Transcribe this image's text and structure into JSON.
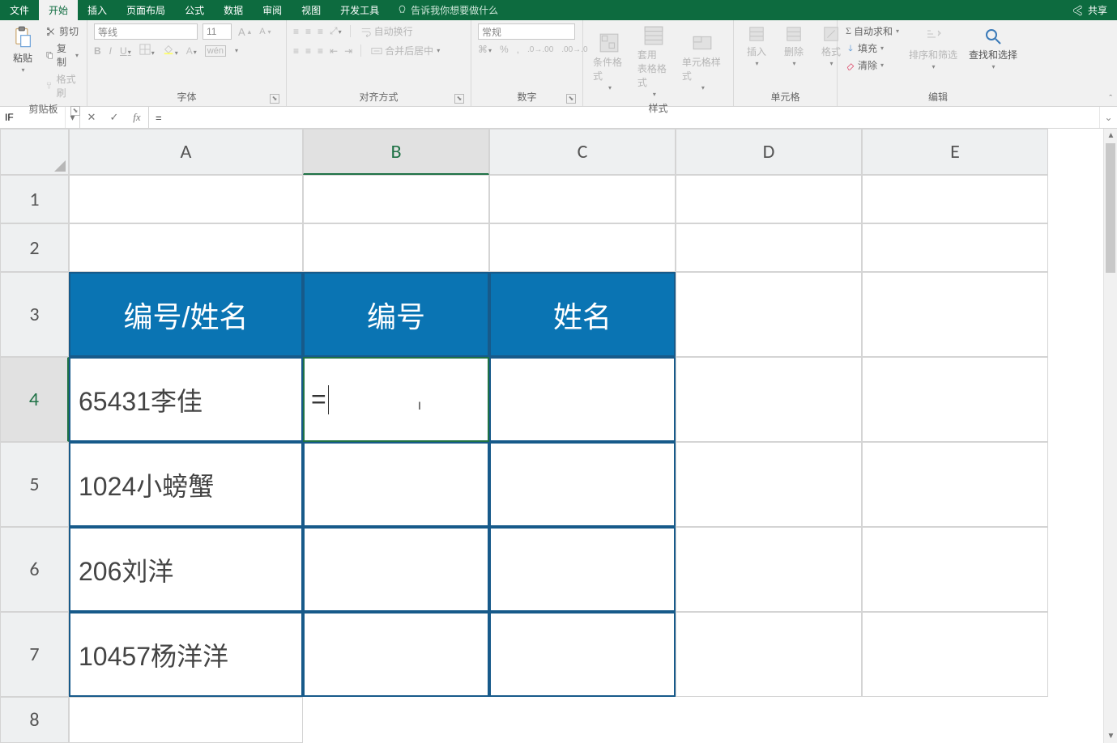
{
  "tabs": {
    "file": "文件",
    "home": "开始",
    "insert": "插入",
    "layout": "页面布局",
    "formulas": "公式",
    "data": "数据",
    "review": "审阅",
    "view": "视图",
    "dev": "开发工具",
    "tell": "告诉我你想要做什么",
    "share": "共享"
  },
  "ribbon": {
    "clipboard": {
      "paste": "粘贴",
      "cut": "剪切",
      "copy": "复制",
      "format_painter": "格式刷",
      "label": "剪贴板"
    },
    "font": {
      "name": "等线",
      "size": "11",
      "label": "字体"
    },
    "align": {
      "wrap": "自动换行",
      "merge": "合并后居中",
      "label": "对齐方式"
    },
    "number": {
      "format": "常规",
      "label": "数字"
    },
    "styles": {
      "cond": "条件格式",
      "table": "套用\n表格格式",
      "cell": "单元格样式",
      "label": "样式"
    },
    "cells": {
      "insert": "插入",
      "delete": "删除",
      "format": "格式",
      "label": "单元格"
    },
    "editing": {
      "sum": "自动求和",
      "fill": "填充",
      "clear": "清除",
      "sort": "排序和筛选",
      "find": "查找和选择",
      "label": "编辑"
    }
  },
  "formula_bar": {
    "name_box": "IF",
    "formula": "="
  },
  "columns": [
    "A",
    "B",
    "C",
    "D",
    "E"
  ],
  "rows": [
    "1",
    "2",
    "3",
    "4",
    "5",
    "6",
    "7",
    "8"
  ],
  "table": {
    "headers": {
      "A": "编号/姓名",
      "B": "编号",
      "C": "姓名"
    },
    "data": [
      {
        "A": "65431李佳",
        "B": "=",
        "C": ""
      },
      {
        "A": "1024小螃蟹",
        "B": "",
        "C": ""
      },
      {
        "A": "206刘洋",
        "B": "",
        "C": ""
      },
      {
        "A": "10457杨洋洋",
        "B": "",
        "C": ""
      }
    ]
  },
  "active_cell": "B4"
}
